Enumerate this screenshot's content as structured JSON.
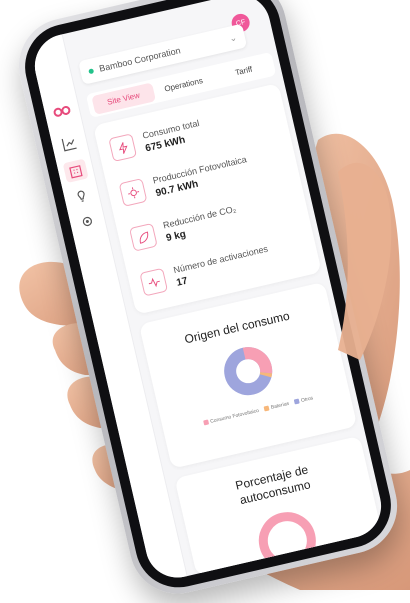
{
  "header": {
    "organization": "Bamboo Corporation",
    "avatar_initials": "CF"
  },
  "tabs": [
    {
      "label": "Site View",
      "active": true
    },
    {
      "label": "Operations",
      "active": false
    },
    {
      "label": "Tariff",
      "active": false
    }
  ],
  "metrics": [
    {
      "label": "Consumo total",
      "value": "675 kWh",
      "icon": "lightning-icon"
    },
    {
      "label": "Producción Fotovoltaica",
      "value": "90.7 kWh",
      "icon": "solar-panel-icon"
    },
    {
      "label": "Reducción de CO₂",
      "value": "9 kg",
      "icon": "leaf-icon"
    },
    {
      "label": "Número de activaciones",
      "value": "17",
      "icon": "activity-icon"
    }
  ],
  "origin_chart": {
    "title": "Origen del consumo",
    "legend": [
      "Consumo Fotovoltaico",
      "Baterías",
      "Otros"
    ],
    "colors": [
      "#f79fb4",
      "#f7b77a",
      "#9ea5dd"
    ]
  },
  "self_consumption": {
    "title_line1": "Porcentaje de",
    "title_line2": "autoconsumo"
  },
  "colors": {
    "accent": "#e74b7c",
    "brand_pink": "#f0589a"
  }
}
